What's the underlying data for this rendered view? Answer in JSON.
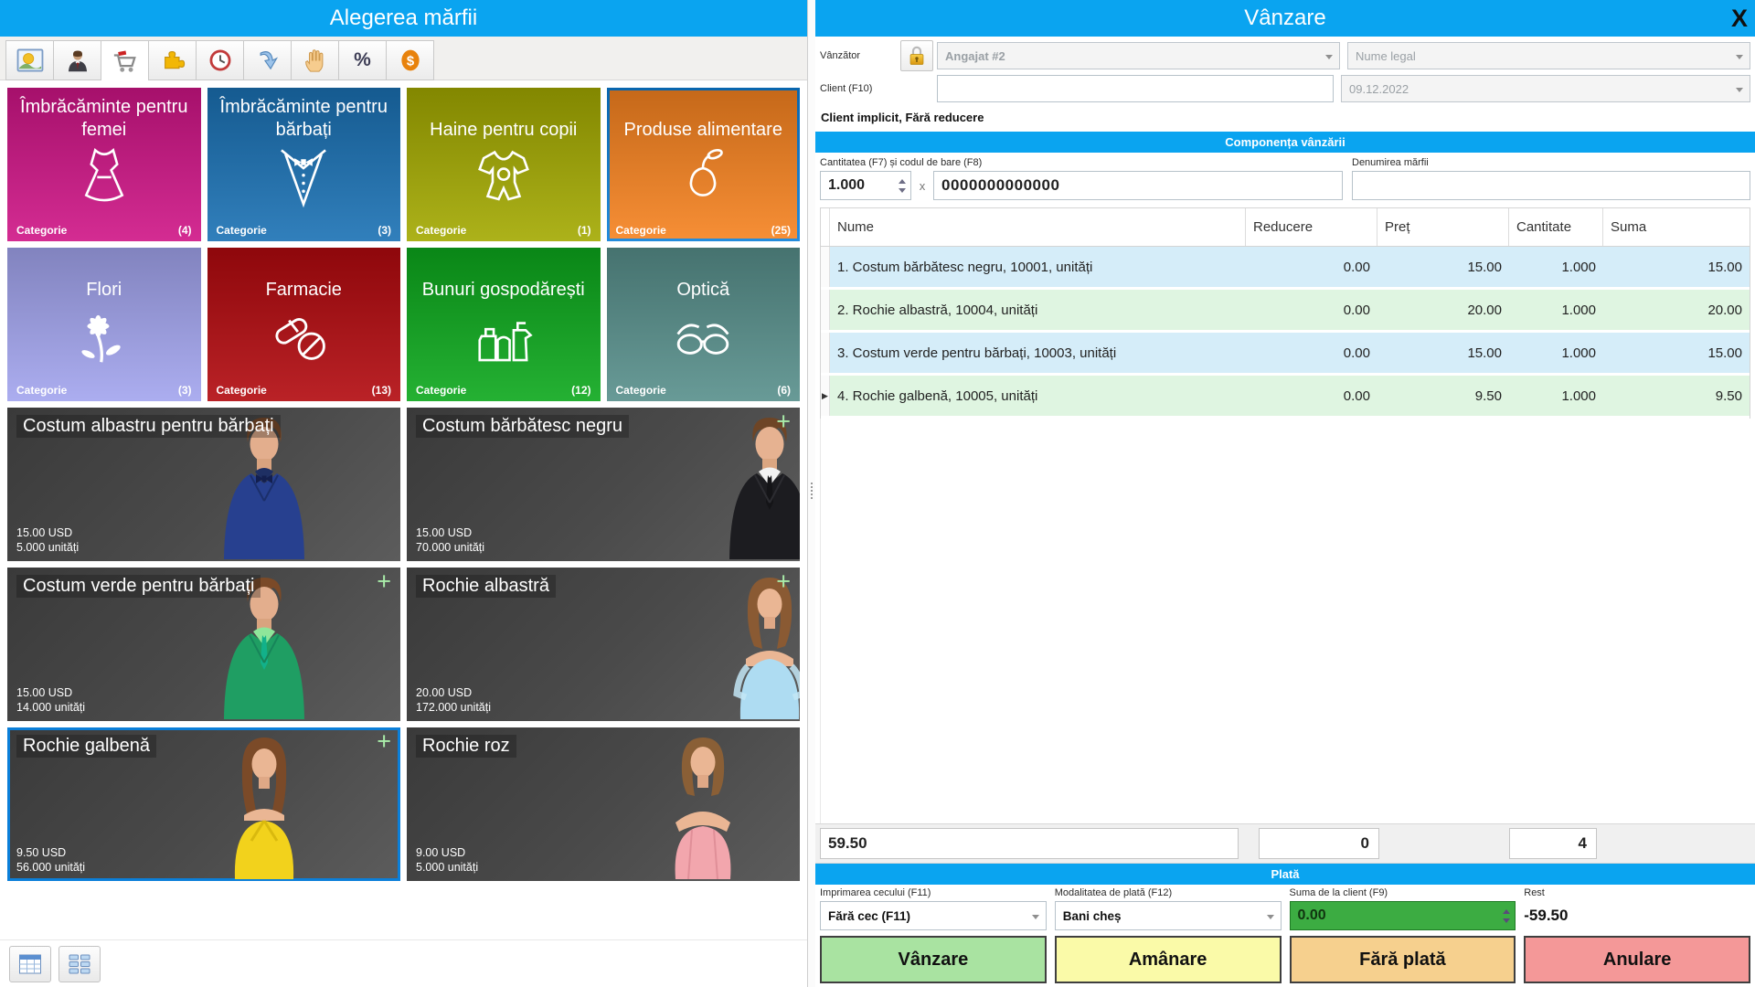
{
  "colors": {
    "accent_blue": "#0aa4f0",
    "selection_border": "#0b7fd9",
    "row_blue": "#d5edf9",
    "row_green": "#dff5e1",
    "client_amount_green": "#3cac42"
  },
  "left_panel": {
    "title": "Alegerea mărfii",
    "toolbar": {
      "icons": [
        {
          "name": "picture"
        },
        {
          "name": "person"
        },
        {
          "name": "cart"
        },
        {
          "name": "puzzle"
        },
        {
          "name": "clock"
        },
        {
          "name": "curved-arrow"
        },
        {
          "name": "hand"
        },
        {
          "name": "percent",
          "glyph": "%"
        },
        {
          "name": "dollar",
          "glyph": "$"
        }
      ],
      "active_index": 2
    },
    "category_label": "Categorie",
    "categories": [
      {
        "name": "Îmbrăcăminte pentru femei",
        "count": "(4)",
        "color": "#cf1486",
        "icon": "dress"
      },
      {
        "name": "Îmbrăcăminte pentru bărbați",
        "count": "(3)",
        "color": "#1a71b4",
        "icon": "tuxedo"
      },
      {
        "name": "Haine pentru copii",
        "count": "(1)",
        "color": "#a3a900",
        "icon": "baby-clothes"
      },
      {
        "name": "Produse alimentare",
        "count": "(25)",
        "color": "#f6821f",
        "icon": "pear",
        "selected": true
      },
      {
        "name": "Flori",
        "count": "(3)",
        "color": "#a2a4ee",
        "icon": "flower"
      },
      {
        "name": "Farmacie",
        "count": "(13)",
        "color": "#b2090e",
        "icon": "pills"
      },
      {
        "name": "Bunuri gospodărești",
        "count": "(12)",
        "color": "#0ca81c",
        "icon": "household"
      },
      {
        "name": "Optică",
        "count": "(6)",
        "color": "#578f8b",
        "icon": "glasses"
      }
    ],
    "products": [
      {
        "name": "Costum albastru pentru bărbați",
        "price": "15.00 USD",
        "stock": "5.000 unități",
        "plus": ""
      },
      {
        "name": "Costum bărbătesc negru",
        "price": "15.00 USD",
        "stock": "70.000 unități",
        "plus": "+"
      },
      {
        "name": "Costum verde pentru bărbați",
        "price": "15.00 USD",
        "stock": "14.000 unități",
        "plus": "+"
      },
      {
        "name": "Rochie albastră",
        "price": "20.00 USD",
        "stock": "172.000 unități",
        "plus": "+"
      },
      {
        "name": "Rochie galbenă",
        "price": "9.50 USD",
        "stock": "56.000 unități",
        "plus": "+",
        "selected": true
      },
      {
        "name": "Rochie roz",
        "price": "9.00 USD",
        "stock": "5.000 unități",
        "plus": ""
      }
    ]
  },
  "right_panel": {
    "title": "Vânzare",
    "close_label": "X",
    "seller_label": "Vânzător",
    "seller_value": "Angajat #2",
    "legal_name_value": "Nume legal",
    "client_label": "Client (F10)",
    "client_value": "",
    "date_value": "09.12.2022",
    "client_note": "Client implicit, Fără reducere",
    "sale_section_title": "Componența vânzării",
    "entry": {
      "qty_barcode_label": "Cantitatea (F7) și codul de bare (F8)",
      "qty_value": "1.000",
      "times": "x",
      "barcode_value": "0000000000000",
      "product_name_label": "Denumirea mărfii"
    },
    "table": {
      "headers": [
        "Nume",
        "Reducere",
        "Preț",
        "Cantitate",
        "Suma"
      ],
      "current_row_marker": "▶",
      "rows": [
        {
          "name": "1. Costum bărbătesc negru, 10001, unități",
          "reducere": "0.00",
          "pret": "15.00",
          "cantitate": "1.000",
          "suma": "15.00"
        },
        {
          "name": "2. Rochie albastră, 10004, unități",
          "reducere": "0.00",
          "pret": "20.00",
          "cantitate": "1.000",
          "suma": "20.00"
        },
        {
          "name": "3. Costum verde pentru bărbați, 10003, unități",
          "reducere": "0.00",
          "pret": "15.00",
          "cantitate": "1.000",
          "suma": "15.00"
        },
        {
          "name": "4. Rochie galbenă, 10005, unități",
          "reducere": "0.00",
          "pret": "9.50",
          "cantitate": "1.000",
          "suma": "9.50"
        }
      ]
    },
    "totals": {
      "sum": "59.50",
      "discount": "0",
      "count": "4"
    },
    "payment_section_title": "Plată",
    "payment": {
      "receipt_label": "Imprimarea cecului (F11)",
      "receipt_value": "Fără cec (F11)",
      "method_label": "Modalitatea de plată (F12)",
      "method_value": "Bani cheș",
      "client_amount_label": "Suma de la client (F9)",
      "client_amount_value": "0.00",
      "rest_label": "Rest",
      "rest_value": "-59.50"
    },
    "actions": [
      {
        "label": "Vânzare",
        "color": "#a9e3a1"
      },
      {
        "label": "Amânare",
        "color": "#fafaa8"
      },
      {
        "label": "Fără plată",
        "color": "#f6d08e"
      },
      {
        "label": "Anulare",
        "color": "#f49898"
      }
    ]
  }
}
